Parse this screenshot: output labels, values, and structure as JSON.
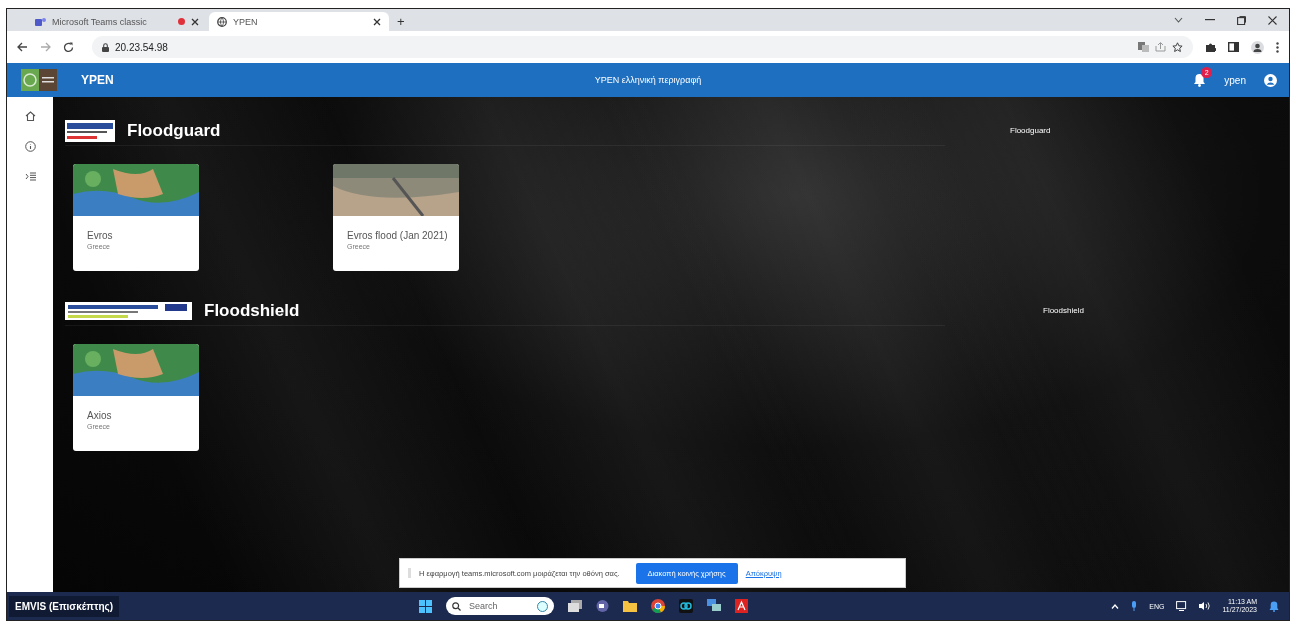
{
  "browser": {
    "tabs": [
      {
        "title": "Microsoft Teams classic",
        "selected": false,
        "recording": true
      },
      {
        "title": "YPEN",
        "selected": true,
        "recording": false
      }
    ],
    "new_tab": "+",
    "address": "20.23.54.98"
  },
  "app_bar": {
    "title": "YPEN",
    "subtitle": "YPEN ελληνική περιγραφή",
    "notification_count": "2",
    "user": "ypen"
  },
  "sections": [
    {
      "title": "Floodguard",
      "side_label": "Floodguard",
      "kind": "small",
      "cards": [
        {
          "title": "Evros",
          "subtitle": "Greece",
          "kind": "map"
        },
        {
          "title": "Evros flood (Jan 2021)",
          "subtitle": "Greece",
          "kind": "photo"
        }
      ]
    },
    {
      "title": "Floodshield",
      "side_label": "Floodshield",
      "kind": "wide",
      "cards": [
        {
          "title": "Axios",
          "subtitle": "Greece",
          "kind": "map"
        }
      ]
    }
  ],
  "share_bar": {
    "message": "Η εφαρμογή teams.microsoft.com μοιράζεται την οθόνη σας.",
    "stop_button": "Διακοπή κοινής χρήσης",
    "hide_link": "Απόκρυψη"
  },
  "taskbar": {
    "user": "EMVIS (Επισκέπτης)",
    "search_placeholder": "Search",
    "language": "ENG",
    "time": "11:13 AM",
    "date": "11/27/2023"
  }
}
